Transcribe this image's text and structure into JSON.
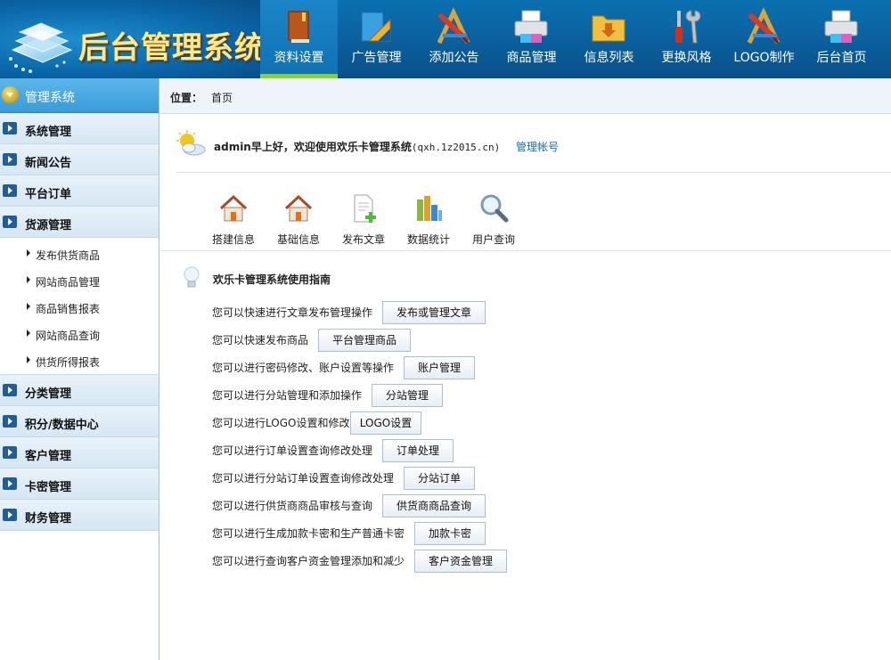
{
  "header": {
    "logo_text": "后台管理系统",
    "nav": [
      {
        "label": "资料设置",
        "icon": "book-icon",
        "active": true
      },
      {
        "label": "广告管理",
        "icon": "ruler-triangle-icon",
        "active": false
      },
      {
        "label": "添加公告",
        "icon": "pencil-ruler-icon",
        "active": false
      },
      {
        "label": "商品管理",
        "icon": "printer-icon",
        "active": false
      },
      {
        "label": "信息列表",
        "icon": "folder-download-icon",
        "active": false
      },
      {
        "label": "更换风格",
        "icon": "tools-icon",
        "active": false
      },
      {
        "label": "LOGO制作",
        "icon": "pencil-ruler-icon",
        "active": false
      },
      {
        "label": "后台首页",
        "icon": "printer-icon",
        "active": false
      }
    ]
  },
  "sidebar": {
    "title": "管理系统",
    "groups_top": [
      {
        "label": "系统管理"
      },
      {
        "label": "新闻公告"
      },
      {
        "label": "平台订单"
      },
      {
        "label": "货源管理"
      }
    ],
    "sub_items": [
      {
        "label": "发布供货商品"
      },
      {
        "label": "网站商品管理"
      },
      {
        "label": "商品销售报表"
      },
      {
        "label": "网站商品查询"
      },
      {
        "label": "供货所得报表"
      }
    ],
    "groups_bottom": [
      {
        "label": "分类管理"
      },
      {
        "label": "积分/数据中心"
      },
      {
        "label": "客户管理"
      },
      {
        "label": "卡密管理"
      },
      {
        "label": "财务管理"
      }
    ]
  },
  "breadcrumb": {
    "label": "位置：",
    "value": "首页"
  },
  "welcome": {
    "message": "admin早上好，欢迎使用欢乐卡管理系统",
    "domain": "(qxh.1z2015.cn)",
    "account_link": "管理帐号"
  },
  "quick_links": [
    {
      "label": "搭建信息",
      "icon": "house-icon"
    },
    {
      "label": "基础信息",
      "icon": "house-icon"
    },
    {
      "label": "发布文章",
      "icon": "document-add-icon"
    },
    {
      "label": "数据统计",
      "icon": "bar-chart-icon"
    },
    {
      "label": "用户查询",
      "icon": "magnifier-icon"
    }
  ],
  "guide": {
    "title": "欢乐卡管理系统使用指南",
    "rows": [
      {
        "text": "您可以快速进行文章发布管理操作",
        "button": "发布或管理文章"
      },
      {
        "text": "您可以快速发布商品",
        "button": "平台管理商品"
      },
      {
        "text": "您可以进行密码修改、账户设置等操作",
        "button": "账户管理"
      },
      {
        "text": "您可以进行分站管理和添加操作",
        "button": "分站管理"
      },
      {
        "text": "您可以进行LOGO设置和修改",
        "button": "LOGO设置"
      },
      {
        "text": "您可以进行订单设置查询修改处理",
        "button": "订单处理"
      },
      {
        "text": "您可以进行分站订单设置查询修改处理",
        "button": "分站订单"
      },
      {
        "text": "您可以进行供货商商品审核与查询",
        "button": "供货商商品查询"
      },
      {
        "text": "您可以进行生成加款卡密和生产普通卡密",
        "button": "加款卡密"
      },
      {
        "text": "您可以进行查询客户资金管理添加和减少",
        "button": "客户资金管理"
      }
    ]
  }
}
